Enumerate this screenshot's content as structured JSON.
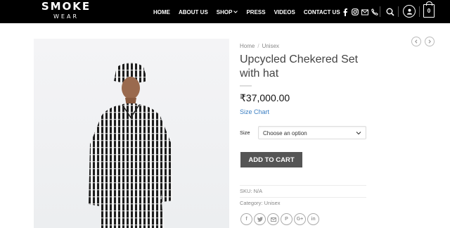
{
  "header": {
    "logo_main": "SMOKE",
    "logo_sub": "WEAR",
    "nav": [
      {
        "label": "HOME"
      },
      {
        "label": "ABOUT US"
      },
      {
        "label": "SHOP"
      },
      {
        "label": "PRESS"
      },
      {
        "label": "VIDEOS"
      },
      {
        "label": "CONTACT US"
      }
    ],
    "social_icons": [
      "facebook-icon",
      "instagram-icon",
      "email-icon",
      "phone-icon"
    ],
    "cart_count": "0"
  },
  "product": {
    "breadcrumb": [
      "Home",
      "Unisex"
    ],
    "title": "Upcycled Chekered Set with hat",
    "price": "₹37,000.00",
    "size_chart_label": "Size Chart",
    "size_label": "Size",
    "size_placeholder": "Choose an option",
    "add_to_cart": "ADD TO CART",
    "sku_label": "SKU:",
    "sku_value": "N/A",
    "category_label": "Category:",
    "category_value": "Unisex",
    "share_icons": [
      "facebook-icon",
      "twitter-icon",
      "email-icon",
      "pinterest-icon",
      "google-plus-icon",
      "linkedin-icon"
    ]
  },
  "colors": {
    "header_bg": "#000000",
    "link_blue": "#3a7ec2",
    "button_bg": "#555555"
  }
}
